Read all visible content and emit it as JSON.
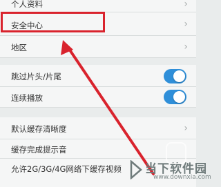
{
  "settings": {
    "group1": [
      {
        "label": "个人资料"
      },
      {
        "label": "安全中心"
      },
      {
        "label": "地区"
      }
    ],
    "group2": [
      {
        "label": "跳过片头/片尾",
        "on": true
      },
      {
        "label": "连续播放",
        "on": true
      }
    ],
    "group3": [
      {
        "label": "默认缓存清晰度"
      },
      {
        "label": "缓存完成提示音"
      },
      {
        "label": "允许2G/3G/4G网络下缓存视频"
      }
    ]
  },
  "icons": {
    "chevron": "chevron-right-icon"
  },
  "colors": {
    "toggle_on": "#2f8fd9",
    "highlight": "#d9232d"
  },
  "watermark": {
    "brand": "当下软件园",
    "url": "www.downxia.com"
  }
}
